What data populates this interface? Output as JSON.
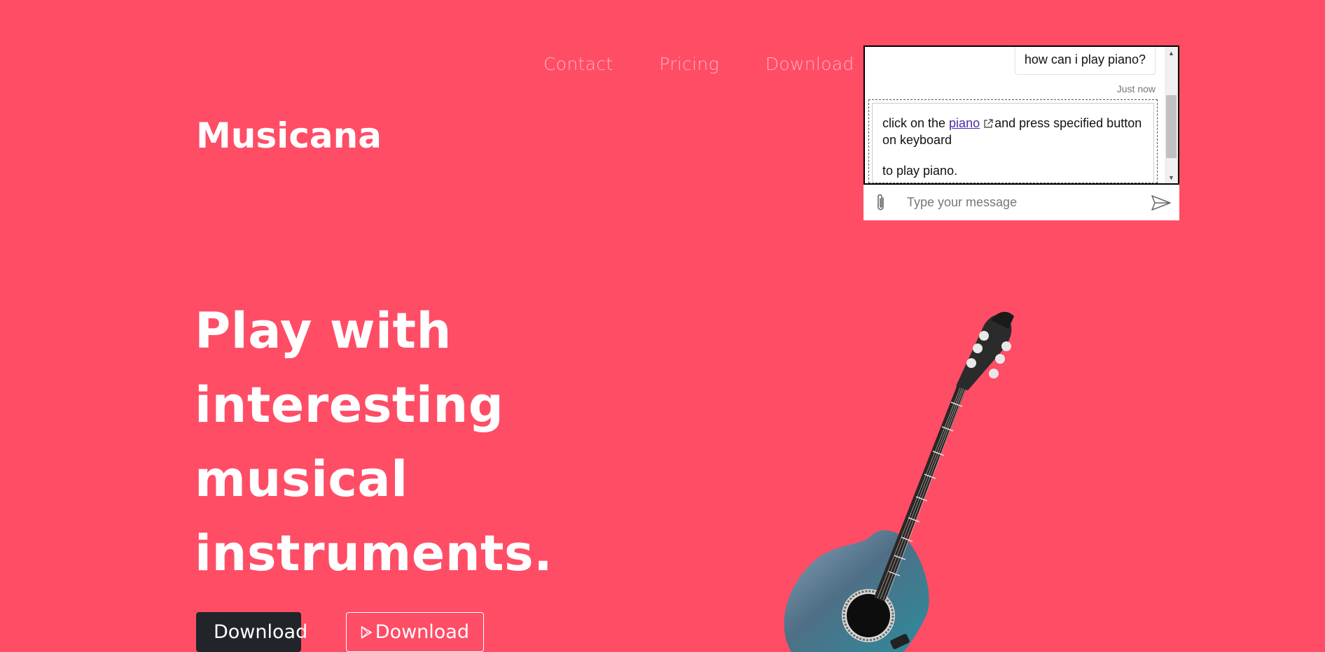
{
  "nav": {
    "items": [
      "Contact",
      "Pricing",
      "Download"
    ]
  },
  "brand": "Musicana",
  "hero": {
    "line1": "Play with",
    "line2": "interesting",
    "line3": "musical",
    "line4": "instruments."
  },
  "buttons": {
    "apple_label": "Download",
    "play_label": "Download"
  },
  "chat": {
    "user_message": "how can i play piano?",
    "timestamp": "Just now",
    "bot_text_before_link": "click on the ",
    "bot_link": "piano",
    "bot_text_after_link": "and press specified button on keyboard",
    "bot_text_second": "to play piano.",
    "input_placeholder": "Type your message"
  },
  "colors": {
    "background": "#ff4d66",
    "dark_button": "#212529",
    "link": "#4b2aa6"
  }
}
